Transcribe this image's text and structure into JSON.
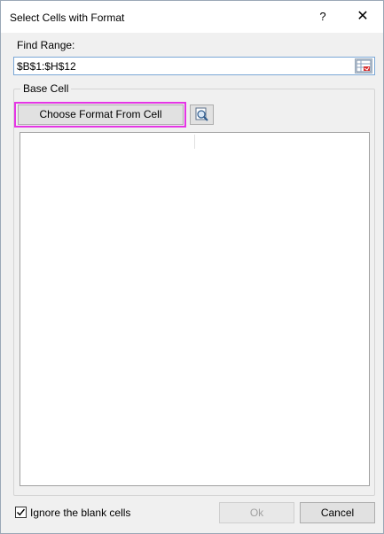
{
  "window": {
    "title": "Select Cells with Format",
    "help_label": "?",
    "close_label": "✕"
  },
  "find_range": {
    "label": "Find Range:",
    "value": "$B$1:$H$12"
  },
  "base_cell": {
    "group_label": "Base Cell",
    "choose_button_label": "Choose Format From Cell",
    "highlight_color": "#e535e5"
  },
  "options": {
    "ignore_blank_label": "Ignore the blank cells",
    "ignore_blank_checked": true
  },
  "buttons": {
    "ok_label": "Ok",
    "cancel_label": "Cancel"
  }
}
